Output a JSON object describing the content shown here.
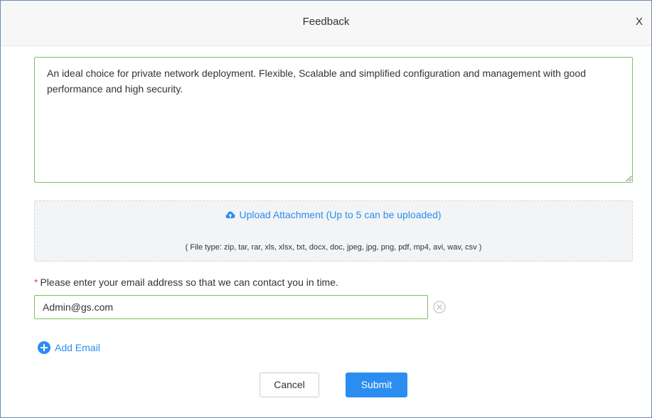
{
  "dialog": {
    "title": "Feedback",
    "close_label": "X"
  },
  "feedback": {
    "text": "An ideal choice for private network deployment. Flexible, Scalable and simplified configuration and management with good performance and high security."
  },
  "upload": {
    "icon": "cloud-upload-icon",
    "link_label": "Upload Attachment (Up to 5 can be uploaded)",
    "file_types": "( File type: zip, tar, rar, xls, xlsx, txt, docx, doc, jpeg, jpg, png, pdf, mp4, avi, wav, csv )"
  },
  "email": {
    "required_mark": "*",
    "label": "Please enter your email address so that we can contact you in time.",
    "value": "Admin@gs.com",
    "clear_icon": "clear-circle-icon",
    "add_label": "Add Email",
    "add_icon": "plus-circle-icon"
  },
  "buttons": {
    "cancel": "Cancel",
    "submit": "Submit"
  },
  "colors": {
    "accent": "#2b8df0",
    "valid_border": "#7cc35a",
    "required": "#e14c4c"
  }
}
